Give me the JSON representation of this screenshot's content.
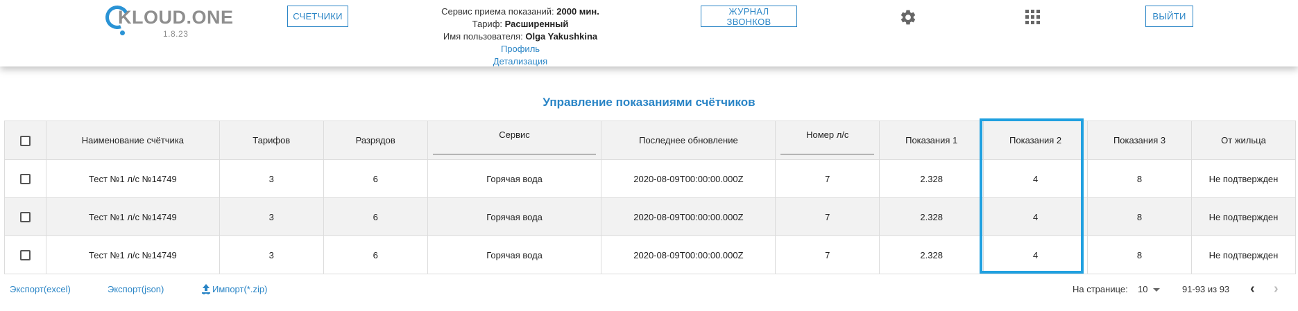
{
  "app": {
    "logo_text": "KLOUD.ONE",
    "version": "1.8.23"
  },
  "header": {
    "meters_button": "СЧЕТЧИКИ",
    "calls_button": "ЖУРНАЛ ЗВОНКОВ",
    "logout_button": "ВЫЙТИ",
    "service_label": "Сервис приема показаний:",
    "service_value": "2000 мин.",
    "tariff_label": "Тариф:",
    "tariff_value": "Расширенный",
    "user_label": "Имя пользователя:",
    "user_value": "Olga Yakushkina",
    "profile_link": "Профиль",
    "details_link": "Детализация",
    "settings_icon": "gear-icon",
    "apps_icon": "grid-icon"
  },
  "page_title": "Управление показаниями счётчиков",
  "table": {
    "columns": [
      "Наименование счётчика",
      "Тарифов",
      "Разрядов",
      "Сервис",
      "Последнее обновление",
      "Номер л/с",
      "Показания 1",
      "Показания 2",
      "Показания 3",
      "От жильца"
    ],
    "rows": [
      [
        "Тест №1 л/с №14749",
        "3",
        "6",
        "Горячая вода",
        "2020-08-09T00:00:00.000Z",
        "7",
        "2.328",
        "4",
        "8",
        "Не подтвержден"
      ],
      [
        "Тест №1 л/с №14749",
        "3",
        "6",
        "Горячая вода",
        "2020-08-09T00:00:00.000Z",
        "7",
        "2.328",
        "4",
        "8",
        "Не подтвержден"
      ],
      [
        "Тест №1 л/с №14749",
        "3",
        "6",
        "Горячая вода",
        "2020-08-09T00:00:00.000Z",
        "7",
        "2.328",
        "4",
        "8",
        "Не подтвержден"
      ]
    ],
    "highlight_color": "#1fa0e0"
  },
  "footer": {
    "export_excel": "Экспорт(excel)",
    "export_json": "Экспорт(json)",
    "import_zip": "Импорт(*.zip)",
    "per_page_label": "На странице:",
    "per_page_value": "10",
    "range": "91-93 из 93"
  },
  "colors": {
    "accent": "#2a85c6"
  }
}
